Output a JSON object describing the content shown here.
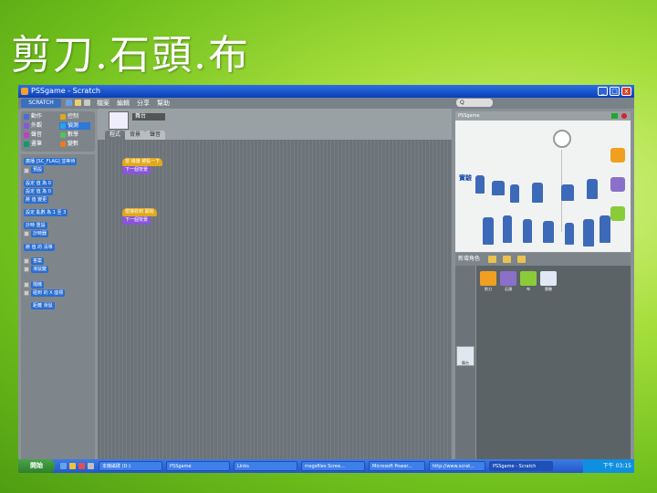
{
  "slide": {
    "title": "剪刀.石頭.布"
  },
  "window": {
    "title": "PSSgame - Scratch",
    "minimize": "_",
    "maximize": "□",
    "close": "x"
  },
  "menubar": {
    "logo": "SCRATCH",
    "items": [
      "檔案",
      "編輯",
      "分享",
      "幫助"
    ],
    "search": "Q"
  },
  "categories": [
    {
      "label": "動作",
      "color": "#4a6cd4"
    },
    {
      "label": "控制",
      "color": "#e1a91a"
    },
    {
      "label": "外觀",
      "color": "#8a55d7"
    },
    {
      "label": "偵測",
      "color": "#2ca5e2"
    },
    {
      "label": "聲音",
      "color": "#bb42c3"
    },
    {
      "label": "數學",
      "color": "#59c059"
    },
    {
      "label": "畫筆",
      "color": "#0e9a6c"
    },
    {
      "label": "變數",
      "color": "#ee7d16"
    }
  ],
  "palette": {
    "blocks": [
      {
        "label": "廣播 [SC_FLAG] 並等待",
        "color": "#2a6ed1"
      },
      {
        "label": "預設",
        "color": "#c7c7c7"
      },
      {
        "label": "設定 值 為 0",
        "color": "#2a6ed1"
      },
      {
        "label": "設定 值 為 0",
        "color": "#2a6ed1"
      },
      {
        "label": "將 值 變更",
        "color": "#2a6ed1"
      },
      {
        "label": "設定 亂數 為 1 至 3",
        "color": "#2a6ed1"
      },
      {
        "label": "計時 重設",
        "color": "#2a6ed1"
      },
      {
        "label": "計時器",
        "color": "#2a6ed1"
      },
      {
        "label": "將 值 的 清單",
        "color": "#2a6ed1"
      },
      {
        "label": "答案",
        "color": "#2a6ed1"
      },
      {
        "label": "滑鼠鍵",
        "color": "#2a6ed1"
      },
      {
        "label": "隨機",
        "color": "#2a6ed1"
      },
      {
        "label": "碰到 的 X 座標",
        "color": "#2a6ed1"
      },
      {
        "label": "距離 滑鼠",
        "color": "#2a6ed1"
      }
    ]
  },
  "sprite": {
    "name": "舞台",
    "tabs": [
      "程式",
      "背景",
      "聲音"
    ]
  },
  "scripts": {
    "script1": {
      "hat": "當 綠旗 被點一下",
      "body": "下一個背景"
    },
    "script2": {
      "hat": "當接收到 開始",
      "body": "下一個背景"
    }
  },
  "stage": {
    "header": "PSSgame",
    "label": "實驗"
  },
  "sprites_panel": {
    "header": "新增角色",
    "items": [
      {
        "label": "剪刀",
        "color": "#f0a020"
      },
      {
        "label": "石頭",
        "color": "#8a70c8"
      },
      {
        "label": "布",
        "color": "#8acb3a"
      },
      {
        "label": "實驗",
        "color": "#e0e8f4"
      }
    ],
    "stage_thumb": "舞台"
  },
  "taskbar": {
    "start": "開始",
    "tasks": [
      {
        "label": "本機磁碟 (D:)"
      },
      {
        "label": "PSSgame"
      },
      {
        "label": "Links"
      },
      {
        "label": "msgsfiles Scree..."
      },
      {
        "label": "Microsoft Power..."
      },
      {
        "label": "http://www.scrat..."
      },
      {
        "label": "PSSgame - Scratch"
      }
    ],
    "tray": "下午 03:15"
  }
}
